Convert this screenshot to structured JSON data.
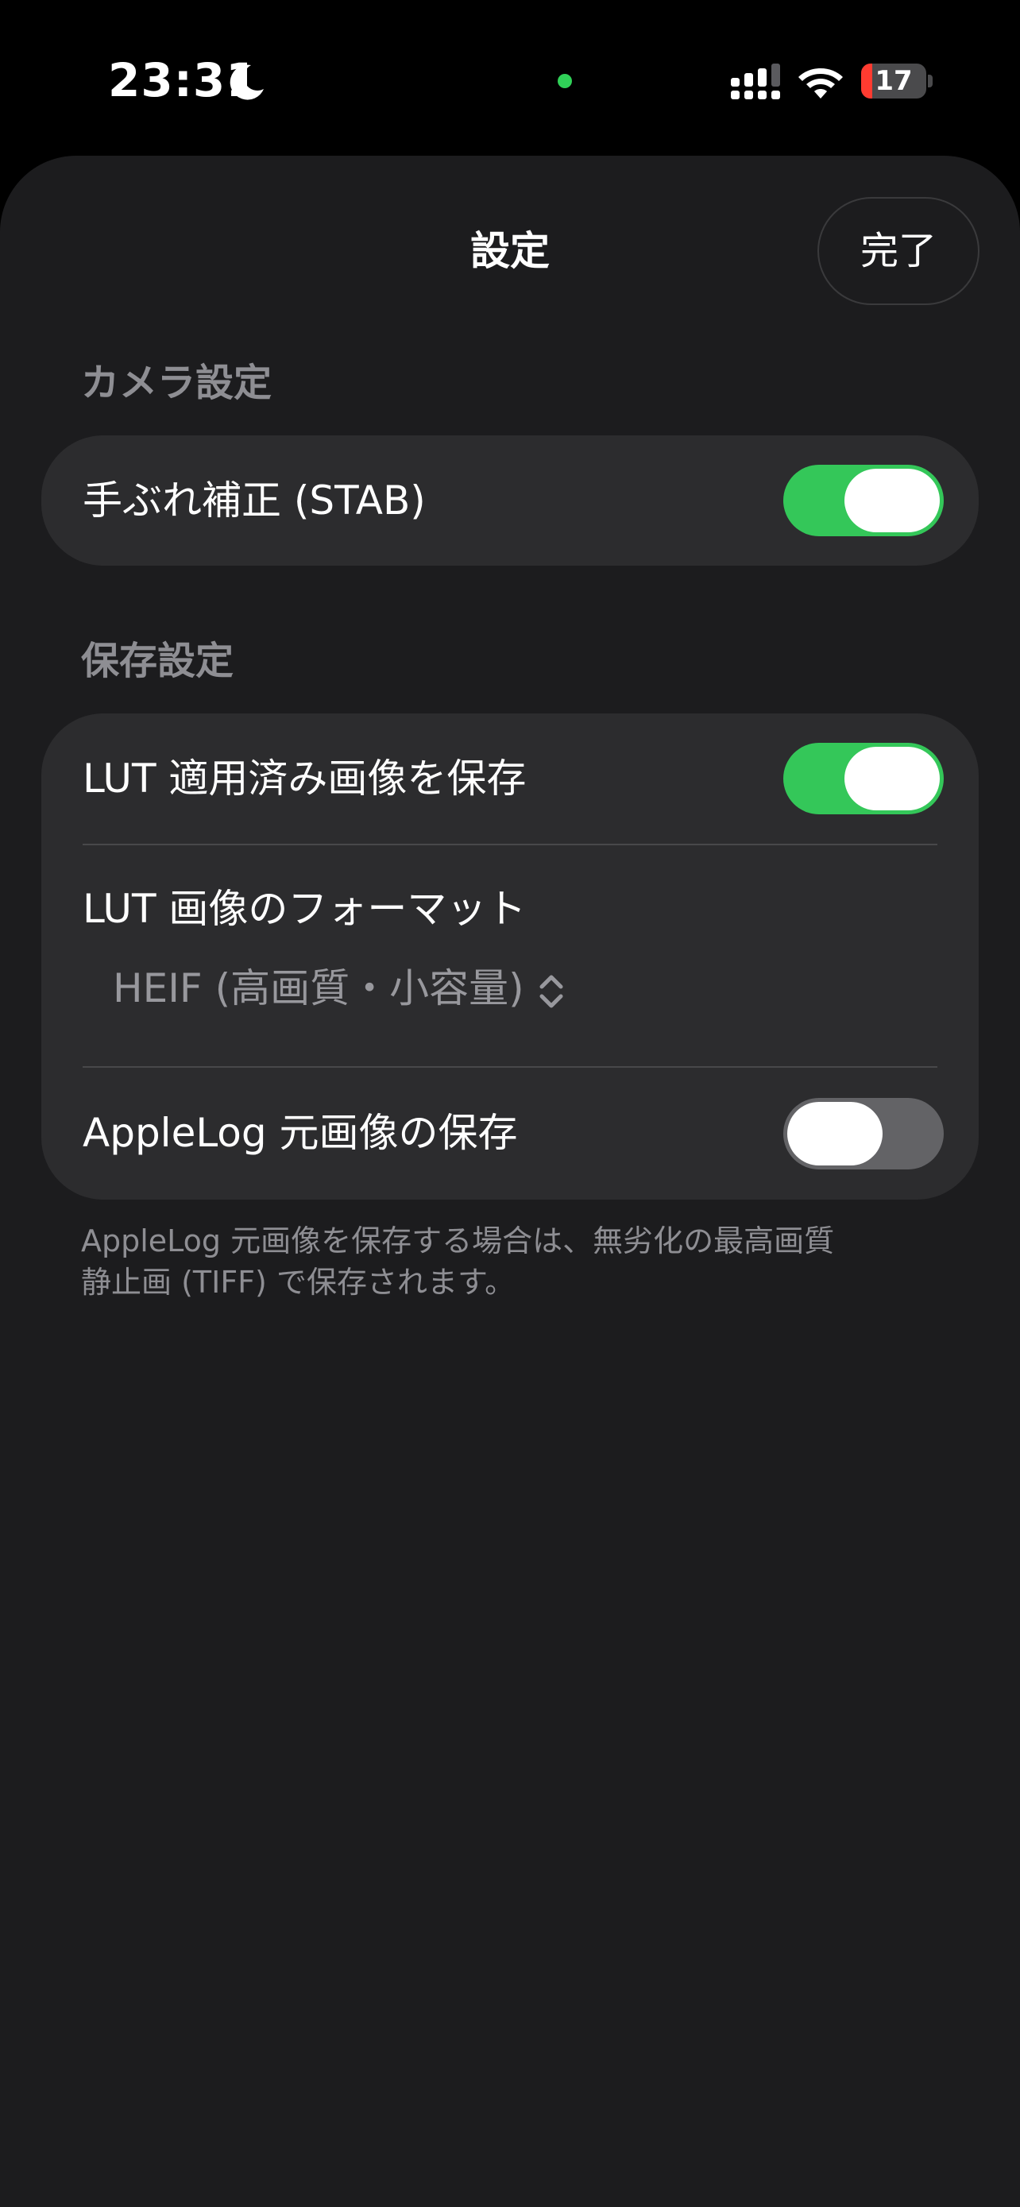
{
  "status_bar": {
    "time": "23:31",
    "battery_level": "17",
    "battery_fraction": 0.17,
    "icons": [
      "moon-icon",
      "camera-in-use-dot",
      "cellular-signal-icon",
      "wifi-icon",
      "battery-icon"
    ]
  },
  "nav": {
    "title": "設定",
    "done_label": "完了"
  },
  "camera_section": {
    "header": "カメラ設定",
    "stabilization_label": "手ぶれ補正 (STAB)",
    "stabilization_on": true
  },
  "save_section": {
    "header": "保存設定",
    "save_lut_label": "LUT 適用済み画像を保存",
    "save_lut_on": true,
    "lut_format_label": "LUT 画像のフォーマット",
    "lut_format_value": "HEIF (高画質・小容量)",
    "applelog_label": "AppleLog 元画像の保存",
    "applelog_on": false,
    "footer": "AppleLog 元画像を保存する場合は、無劣化の最高画質\n静止画 (TIFF) で保存されます。"
  },
  "colors": {
    "accent_green": "#34c759",
    "sheet_background": "#1c1c1e",
    "group_background": "#2c2c2e",
    "secondary_text": "#8e8e93"
  }
}
